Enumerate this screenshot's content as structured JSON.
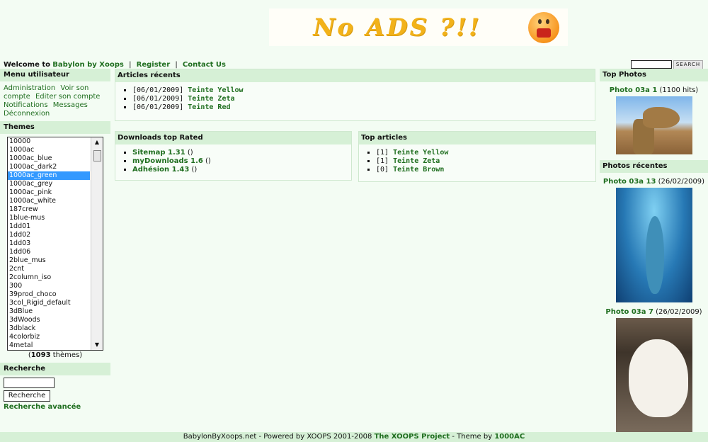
{
  "banner": {
    "text": "No ADS ?!!"
  },
  "header": {
    "welcome": "Welcome to",
    "site_name": "Babylon by Xoops",
    "register": "Register",
    "contact": "Contact Us",
    "search_button": "SEARCH"
  },
  "left": {
    "menu_title": "Menu utilisateur",
    "menu_items": [
      "Administration",
      "Voir son compte",
      "Editer son compte",
      "Notifications",
      "Messages",
      "Déconnexion"
    ],
    "themes_title": "Themes",
    "themes": [
      "10000",
      "1000ac",
      "1000ac_blue",
      "1000ac_dark2",
      "1000ac_green",
      "1000ac_grey",
      "1000ac_pink",
      "1000ac_white",
      "187crew",
      "1blue-mus",
      "1dd01",
      "1dd02",
      "1dd03",
      "1dd06",
      "2blue_mus",
      "2cnt",
      "2column_iso",
      "300",
      "39prod_choco",
      "3col_Rigid_default",
      "3dBlue",
      "3dWoods",
      "3dblack",
      "4colorbiz",
      "4metal"
    ],
    "selected_theme": "1000ac_green",
    "theme_count": "1093",
    "theme_count_suffix": "thèmes",
    "search_title": "Recherche",
    "search_button": "Recherche",
    "advanced_search": "Recherche avancée"
  },
  "center": {
    "recent_articles": {
      "title": "Articles récents",
      "items": [
        {
          "date": "[06/01/2009]",
          "name": "Teinte Yellow"
        },
        {
          "date": "[06/01/2009]",
          "name": "Teinte Zeta"
        },
        {
          "date": "[06/01/2009]",
          "name": "Teinte Red"
        }
      ]
    },
    "downloads": {
      "title": "Downloads top Rated",
      "items": [
        {
          "name": "Sitemap 1.31",
          "extra": "()"
        },
        {
          "name": "myDownloads 1.6",
          "extra": "()"
        },
        {
          "name": "Adhésion 1.43",
          "extra": "()"
        }
      ]
    },
    "top_articles": {
      "title": "Top articles",
      "items": [
        {
          "count": "[1]",
          "name": "Teinte Yellow"
        },
        {
          "count": "[1]",
          "name": "Teinte Zeta"
        },
        {
          "count": "[0]",
          "name": "Teinte Brown"
        }
      ]
    }
  },
  "right": {
    "top_photos_title": "Top Photos",
    "top_photo": {
      "name": "Photo 03a 1",
      "info": "(1100 hits)"
    },
    "recent_photos_title": "Photos récentes",
    "recent_photos": [
      {
        "name": "Photo 03a 13",
        "info": "(26/02/2009)"
      },
      {
        "name": "Photo 03a 7",
        "info": "(26/02/2009)"
      }
    ]
  },
  "footer": {
    "prefix": "BabylonByXoops.net - Powered by XOOPS 2001-2008",
    "project": "The XOOPS Project",
    "middle": "- Theme by",
    "theme_author": "1000AC"
  },
  "colors": {
    "accent_green": "#1f6e1f",
    "title_bg": "#d6f0d6",
    "page_bg": "#f3fcf3"
  }
}
